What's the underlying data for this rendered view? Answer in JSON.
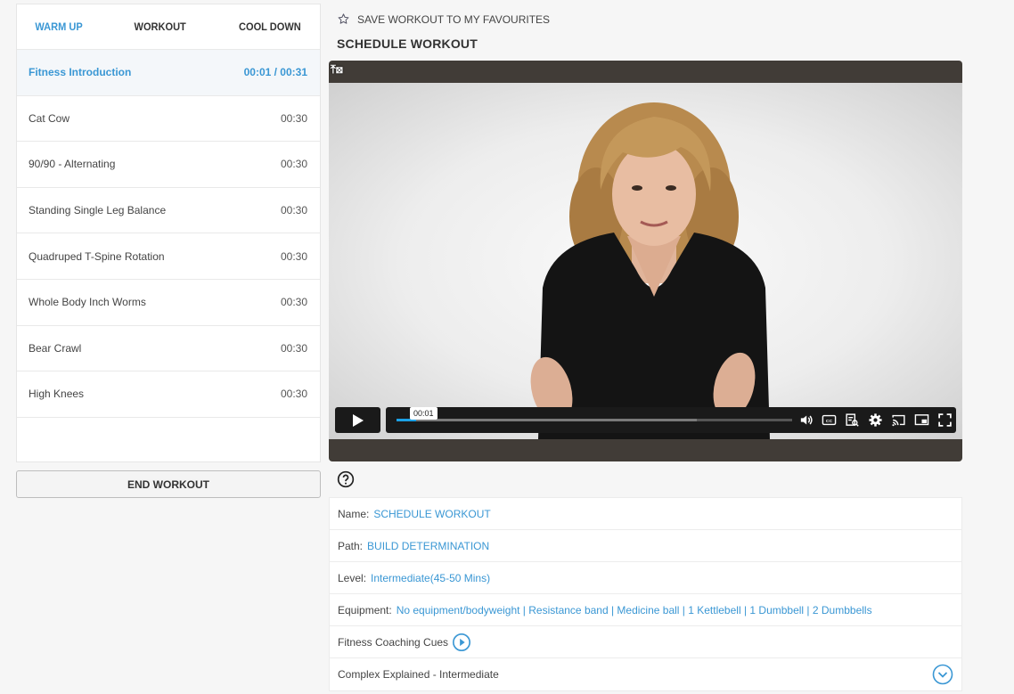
{
  "tabs": [
    {
      "label": "WARM UP",
      "active": true
    },
    {
      "label": "WORKOUT",
      "active": false
    },
    {
      "label": "COOL DOWN",
      "active": false
    }
  ],
  "exercises": [
    {
      "name": "Fitness Introduction",
      "time": "00:01 / 00:31",
      "active": true
    },
    {
      "name": "Cat Cow",
      "time": "00:30",
      "active": false
    },
    {
      "name": "90/90 - Alternating",
      "time": "00:30",
      "active": false
    },
    {
      "name": "Standing Single Leg Balance",
      "time": "00:30",
      "active": false
    },
    {
      "name": "Quadruped T-Spine Rotation",
      "time": "00:30",
      "active": false
    },
    {
      "name": "Whole Body Inch Worms",
      "time": "00:30",
      "active": false
    },
    {
      "name": "Bear Crawl",
      "time": "00:30",
      "active": false
    },
    {
      "name": "High Knees",
      "time": "00:30",
      "active": false
    }
  ],
  "end_workout_label": "END WORKOUT",
  "favourites_label": "SAVE WORKOUT TO MY FAVOURITES",
  "schedule_title": "SCHEDULE WORKOUT",
  "player": {
    "tooltip_time": "00:01",
    "progress_fraction": 0.05,
    "buffered_fraction": 0.76,
    "accent_color": "#1ca1e6",
    "icons": [
      "volume-icon",
      "captions-icon",
      "transcript-icon",
      "settings-icon",
      "cast-icon",
      "pip-icon",
      "fullscreen-icon"
    ]
  },
  "info": {
    "name_label": "Name:",
    "name_value": "SCHEDULE WORKOUT",
    "path_label": "Path:",
    "path_value": "BUILD DETERMINATION",
    "level_label": "Level:",
    "level_value": "Intermediate(45-50 Mins)",
    "equipment_label": "Equipment:",
    "equipment_value": "No equipment/bodyweight | Resistance band | Medicine ball | 1 Kettlebell | 1 Dumbbell | 2 Dumbbells",
    "coaching_label": "Fitness Coaching Cues",
    "complex_label": "Complex Explained - Intermediate"
  },
  "accent_color": "#3a97d4"
}
